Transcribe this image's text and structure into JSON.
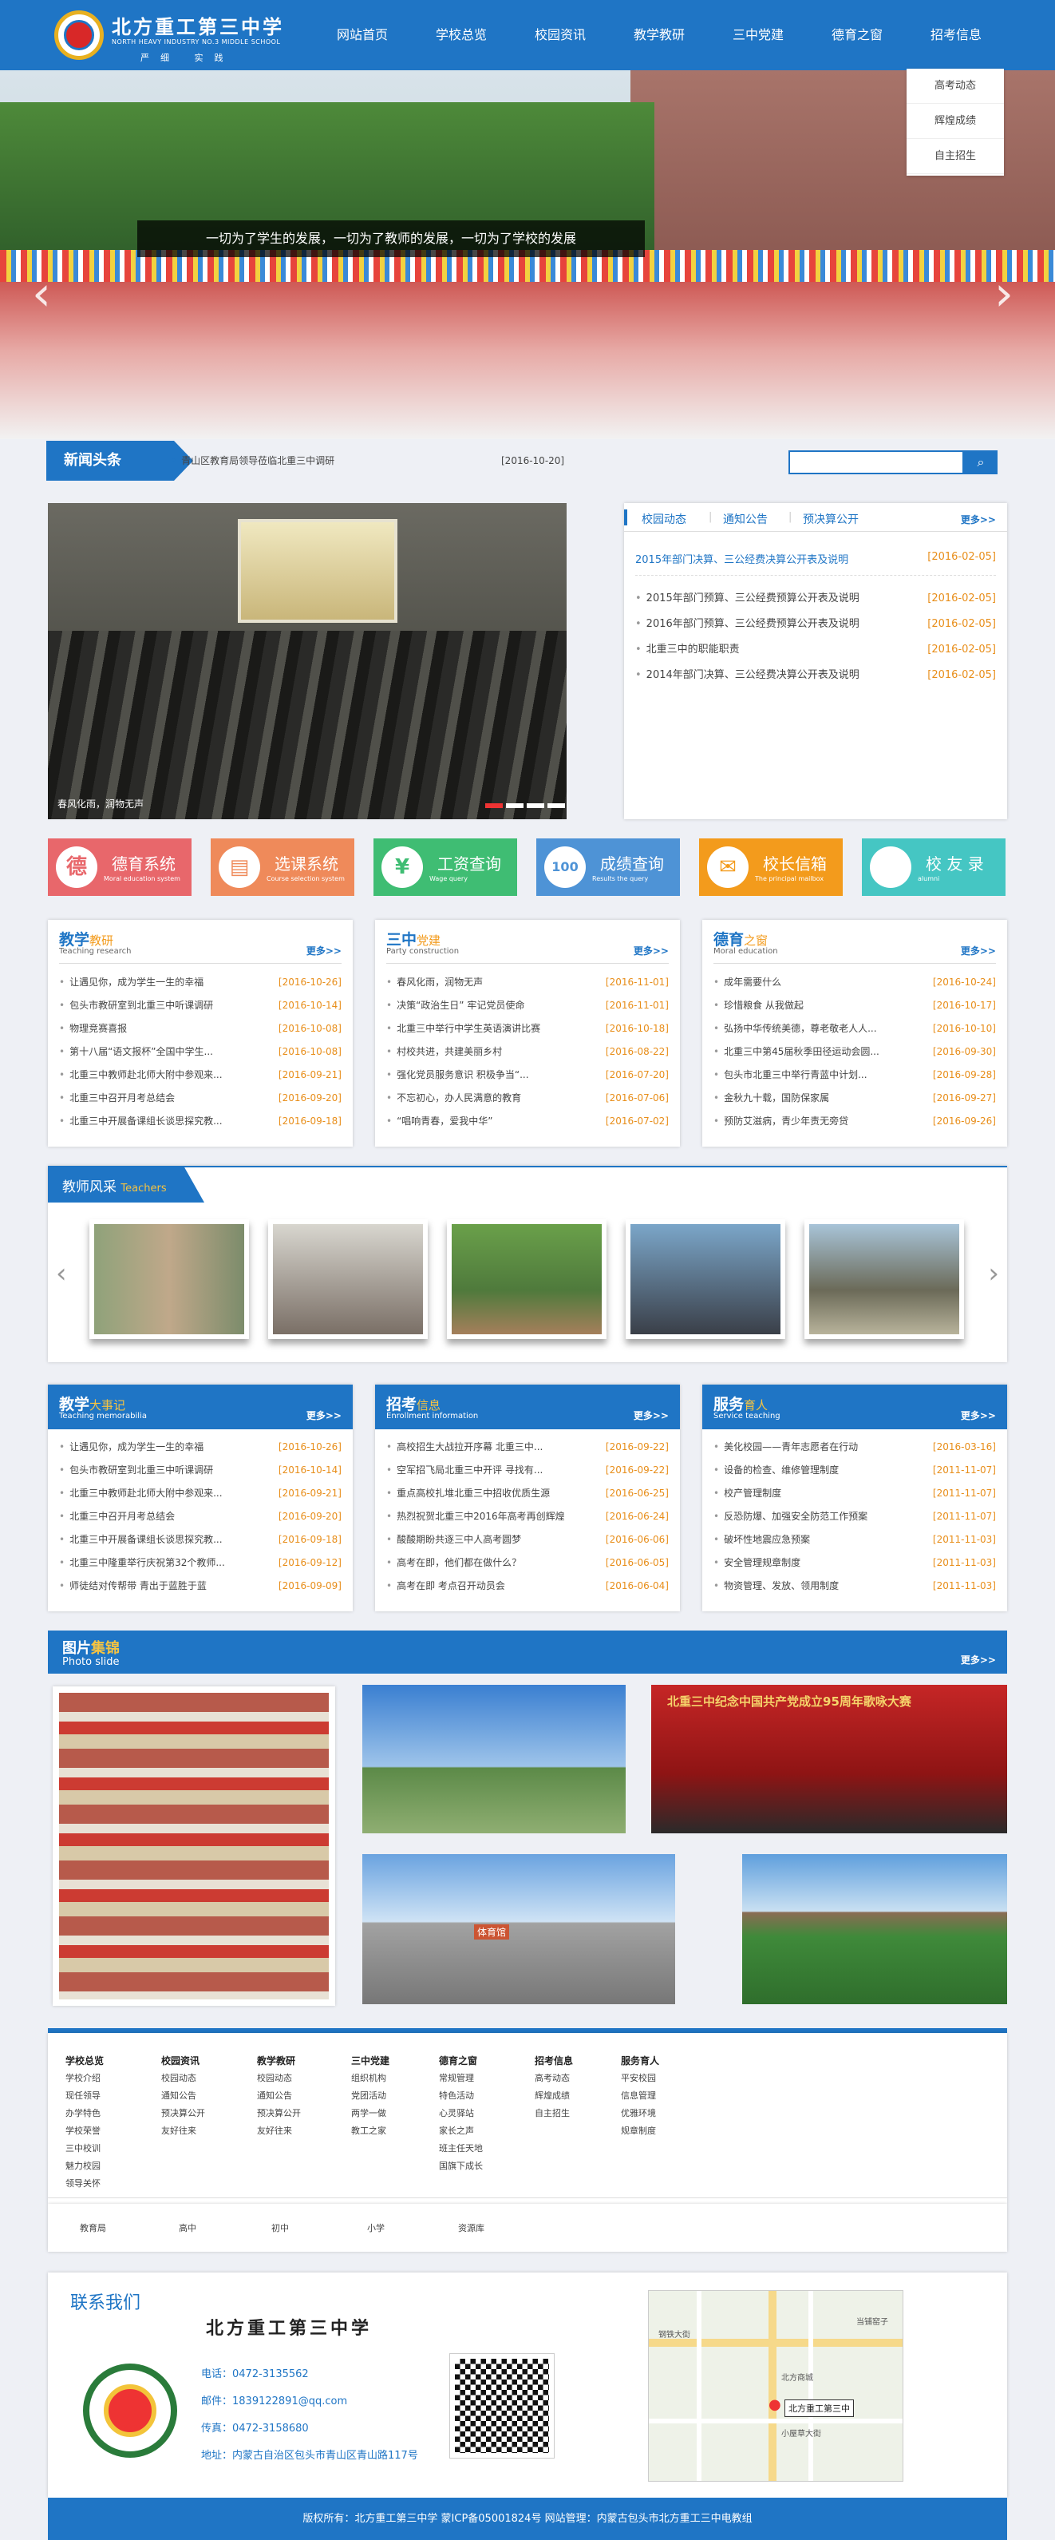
{
  "header": {
    "school_name": "北方重工第三中学",
    "school_en": "NORTH HEAVY INDUSTRY NO.3 MIDDLE SCHOOL",
    "motto": "严细 实践",
    "nav": [
      "网站首页",
      "学校总览",
      "校园资讯",
      "教学教研",
      "三中党建",
      "德育之窗",
      "招考信息"
    ],
    "dropdown": [
      "高考动态",
      "辉煌成绩",
      "自主招生"
    ]
  },
  "banner": {
    "caption": "一切为了学生的发展，一切为了教师的发展，一切为了学校的发展"
  },
  "newsbar": {
    "title": "新闻头条",
    "headline": "青山区教育局领导莅临北重三中调研",
    "date": "[2016-10-20]"
  },
  "photo": {
    "caption": "春风化雨，润物无声"
  },
  "tabs": {
    "labels": [
      "校园动态",
      "通知公告",
      "预决算公开"
    ],
    "more": "更多>>",
    "featured": {
      "title": "2015年部门决算、三公经费决算公开表及说明",
      "date": "[2016-02-05]"
    },
    "items": [
      {
        "title": "2015年部门预算、三公经费预算公开表及说明",
        "date": "[2016-02-05]"
      },
      {
        "title": "2016年部门预算、三公经费预算公开表及说明",
        "date": "[2016-02-05]"
      },
      {
        "title": "北重三中的职能职责",
        "date": "[2016-02-05]"
      },
      {
        "title": "2014年部门决算、三公经费决算公开表及说明",
        "date": "[2016-02-05]"
      }
    ]
  },
  "tiles": [
    {
      "icon": "德",
      "title": "德育系统",
      "sub": "Moral education system",
      "color": "#e8676b"
    },
    {
      "icon": "▤",
      "title": "选课系统",
      "sub": "Course selection system",
      "color": "#ef8a5a"
    },
    {
      "icon": "¥",
      "title": "工资查询",
      "sub": "Wage query",
      "color": "#3fbd73"
    },
    {
      "icon": "100",
      "title": "成绩查询",
      "sub": "Results the query",
      "color": "#4e93d6"
    },
    {
      "icon": "✉",
      "title": "校长信箱",
      "sub": "The principal mailbox",
      "color": "#f39b1c"
    },
    {
      "icon": "",
      "title": "校 友 录",
      "sub": "alumni",
      "color": "#45c6c3"
    }
  ],
  "columns1": [
    {
      "title_a": "教学",
      "title_b": "教研",
      "sub": "Teaching research",
      "more": "更多>>",
      "items": [
        {
          "t": "让遇见你，成为学生一生的幸福",
          "d": "[2016-10-26]"
        },
        {
          "t": "包头市教研室到北重三中听课调研",
          "d": "[2016-10-14]"
        },
        {
          "t": "物理竞赛喜报",
          "d": "[2016-10-08]"
        },
        {
          "t": "第十八届“语文报杯”全国中学生...",
          "d": "[2016-10-08]"
        },
        {
          "t": "北重三中教师赴北师大附中参观来...",
          "d": "[2016-09-21]"
        },
        {
          "t": "北重三中召开月考总结会",
          "d": "[2016-09-20]"
        },
        {
          "t": "北重三中开展备课组长谈思探究教...",
          "d": "[2016-09-18]"
        }
      ]
    },
    {
      "title_a": "三中",
      "title_b": "党建",
      "sub": "Party construction",
      "more": "更多>>",
      "items": [
        {
          "t": "春风化雨，润物无声",
          "d": "[2016-11-01]"
        },
        {
          "t": "决策“政治生日” 牢记党员使命",
          "d": "[2016-11-01]"
        },
        {
          "t": "北重三中举行中学生英语演讲比赛",
          "d": "[2016-10-18]"
        },
        {
          "t": "村校共进，共建美丽乡村",
          "d": "[2016-08-22]"
        },
        {
          "t": "强化党员服务意识 积极争当“...",
          "d": "[2016-07-20]"
        },
        {
          "t": "不忘初心，办人民满意的教育",
          "d": "[2016-07-06]"
        },
        {
          "t": "“唱响青春，爱我中华”",
          "d": "[2016-07-02]"
        }
      ]
    },
    {
      "title_a": "德育",
      "title_b": "之窗",
      "sub": "Moral education",
      "more": "更多>>",
      "items": [
        {
          "t": "成年需要什么",
          "d": "[2016-10-24]"
        },
        {
          "t": "珍惜粮食 从我做起",
          "d": "[2016-10-17]"
        },
        {
          "t": "弘扬中华传统美德，尊老敬老人人...",
          "d": "[2016-10-10]"
        },
        {
          "t": "北重三中第45届秋季田径运动会圆...",
          "d": "[2016-09-30]"
        },
        {
          "t": "包头市北重三中举行青蓝中计划...",
          "d": "[2016-09-28]"
        },
        {
          "t": "金秋九十载，国防保家属",
          "d": "[2016-09-27]"
        },
        {
          "t": "预防艾滋病，青少年责无旁贷",
          "d": "[2016-09-26]"
        }
      ]
    }
  ],
  "teachers": {
    "title": "教师风采",
    "title_en": "Teachers"
  },
  "columns2": [
    {
      "title_a": "教学",
      "title_b": "大事记",
      "sub": "Teaching memorabilia",
      "more": "更多>>",
      "items": [
        {
          "t": "让遇见你，成为学生一生的幸福",
          "d": "[2016-10-26]"
        },
        {
          "t": "包头市教研室到北重三中听课调研",
          "d": "[2016-10-14]"
        },
        {
          "t": "北重三中教师赴北师大附中参观来...",
          "d": "[2016-09-21]"
        },
        {
          "t": "北重三中召开月考总结会",
          "d": "[2016-09-20]"
        },
        {
          "t": "北重三中开展备课组长谈思探究教...",
          "d": "[2016-09-18]"
        },
        {
          "t": "北重三中隆重举行庆祝第32个教师...",
          "d": "[2016-09-12]"
        },
        {
          "t": "师徒结对传帮带 青出于蓝胜于蓝",
          "d": "[2016-09-09]"
        }
      ]
    },
    {
      "title_a": "招考",
      "title_b": "信息",
      "sub": "Enrollment information",
      "more": "更多>>",
      "items": [
        {
          "t": "高校招生大战拉开序幕 北重三中...",
          "d": "[2016-09-22]"
        },
        {
          "t": "空军招飞局北重三中开评 寻找有...",
          "d": "[2016-09-22]"
        },
        {
          "t": "重点高校扎堆北重三中招收优质生源",
          "d": "[2016-06-25]"
        },
        {
          "t": "热烈祝贺北重三中2016年高考再创辉煌",
          "d": "[2016-06-24]"
        },
        {
          "t": "酸酸期盼共逐三中人高考圆梦",
          "d": "[2016-06-06]"
        },
        {
          "t": "高考在即，他们都在做什么？",
          "d": "[2016-06-05]"
        },
        {
          "t": "高考在即 考点召开动员会",
          "d": "[2016-06-04]"
        }
      ]
    },
    {
      "title_a": "服务",
      "title_b": "育人",
      "sub": "Service teaching",
      "more": "更多>>",
      "items": [
        {
          "t": "美化校园——青年志愿者在行动",
          "d": "[2016-03-16]"
        },
        {
          "t": "设备的检查、维修管理制度",
          "d": "[2011-11-07]"
        },
        {
          "t": "校产管理制度",
          "d": "[2011-11-07]"
        },
        {
          "t": "反恐防爆、加强安全防范工作预案",
          "d": "[2011-11-07]"
        },
        {
          "t": "破坏性地震应急预案",
          "d": "[2011-11-03]"
        },
        {
          "t": "安全管理规章制度",
          "d": "[2011-11-03]"
        },
        {
          "t": "物资管理、发放、领用制度",
          "d": "[2011-11-03]"
        }
      ]
    }
  ],
  "gallery": {
    "title_a": "图片",
    "title_b": "集锦",
    "sub": "Photo slide",
    "more": "更多>>",
    "banner_text": "北重三中纪念中国共产党成立95周年歌咏大赛",
    "building_text": "体育馆"
  },
  "footer_links": [
    {
      "h": "学校总览",
      "items": [
        "学校介绍",
        "现任领导",
        "办学特色",
        "学校荣誉",
        "三中校训",
        "魅力校园",
        "领导关怀"
      ]
    },
    {
      "h": "校园资讯",
      "items": [
        "校园动态",
        "通知公告",
        "预决算公开",
        "友好往来"
      ]
    },
    {
      "h": "教学教研",
      "items": [
        "校园动态",
        "通知公告",
        "预决算公开",
        "友好往来"
      ]
    },
    {
      "h": "三中党建",
      "items": [
        "组织机构",
        "党团活动",
        "两学一做",
        "教工之家"
      ]
    },
    {
      "h": "德育之窗",
      "items": [
        "常规管理",
        "特色活动",
        "心灵驿站",
        "家长之声",
        "班主任天地",
        "国旗下成长"
      ]
    },
    {
      "h": "招考信息",
      "items": [
        "高考动态",
        "辉煌成绩",
        "自主招生"
      ]
    },
    {
      "h": "服务育人",
      "items": [
        "平安校园",
        "信息管理",
        "优雅环境",
        "规章制度"
      ]
    }
  ],
  "friend_links": [
    "教育局",
    "高中",
    "初中",
    "小学",
    "资源库"
  ],
  "contact": {
    "title": "联系我们",
    "school_name": "北方重工第三中学",
    "phone": "电话：0472-3135562",
    "email": "邮件：1839122891@qq.com",
    "fax": "传真：0472-3158680",
    "address": "地址：内蒙古自治区包头市青山区青山路117号",
    "map_label": "北方重工第三中",
    "map_streets": [
      "钢铁大街",
      "北方商城",
      "小屋草大街",
      "当铺窑子"
    ]
  },
  "copyright": "版权所有：北方重工第三中学    蒙ICP备05001824号    网站管理：内蒙古包头市北方重工三中电教组"
}
